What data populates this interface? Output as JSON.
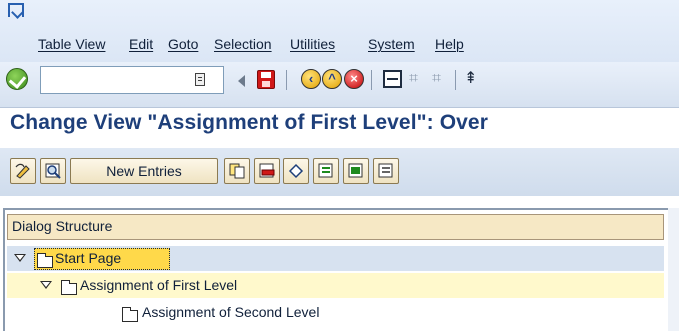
{
  "menu": {
    "items": [
      "Table View",
      "Edit",
      "Goto",
      "Selection",
      "Utilities",
      "System",
      "Help"
    ]
  },
  "standard_toolbar": {
    "command_field": {
      "value": "",
      "placeholder": ""
    },
    "icons": [
      "enter-icon",
      "command-dropdown-icon",
      "back-arrow-icon",
      "save-icon",
      "back-icon",
      "exit-icon",
      "cancel-icon",
      "print-icon",
      "find-icon",
      "find-next-icon",
      "first-page-icon"
    ]
  },
  "title": "Change View \"Assignment of First Level\": Over",
  "application_toolbar": {
    "new_entries_label": "New Entries",
    "icons": [
      "change-display-icon",
      "details-icon",
      "copy-as-icon",
      "delete-icon",
      "undo-icon",
      "select-all-icon",
      "select-block-icon",
      "deselect-all-icon"
    ]
  },
  "dialog_structure": {
    "header": "Dialog Structure",
    "nodes": [
      {
        "label": "Start Page",
        "level": 0,
        "expanded": true,
        "selected": true
      },
      {
        "label": "Assignment of First Level",
        "level": 1,
        "expanded": true,
        "selected": false
      },
      {
        "label": "Assignment of Second Level",
        "level": 2,
        "expanded": false,
        "selected": false
      }
    ]
  },
  "colors": {
    "title": "#1e3f7a",
    "header_bg": "#f6e8c5",
    "selected_node_bg": "#ffd94a",
    "highlight_row_bg": "#fff9cc",
    "start_row_bg": "#d7e2f0"
  }
}
